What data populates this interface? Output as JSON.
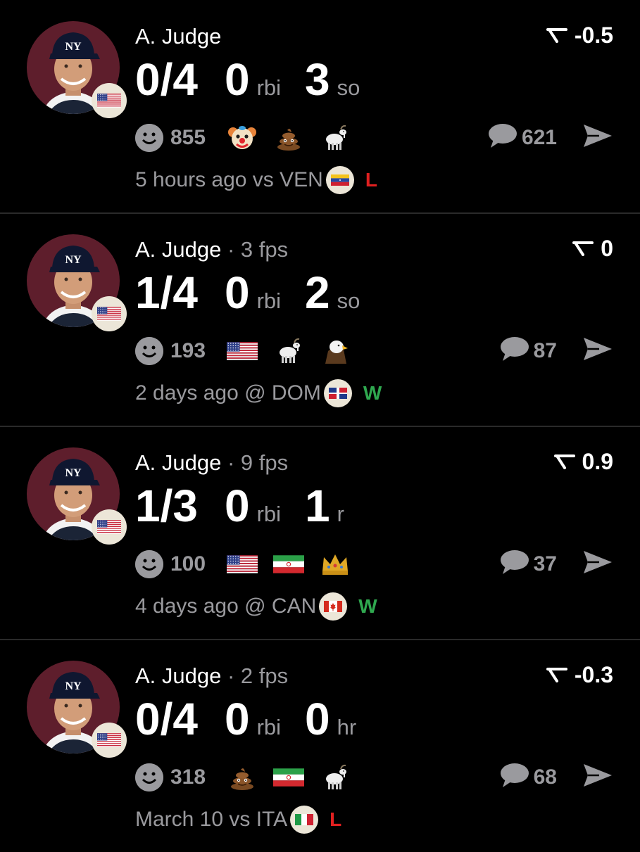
{
  "colors": {
    "loss": "#e02020",
    "win": "#2fa84f",
    "muted": "#9a9a9e",
    "avatar_bg": "#5e1e2c"
  },
  "games": [
    {
      "name": "A. Judge",
      "fps": "",
      "rating": "-0.5",
      "hits": "0/4",
      "rbi": "0",
      "rbi_unit": "rbi",
      "third_val": "3",
      "third_unit": "so",
      "reactions_count": "855",
      "reaction_icons": [
        "clown-emoji",
        "poop-emoji",
        "goat-emoji"
      ],
      "comments": "621",
      "time": "5 hours ago vs VEN",
      "opponent_flag": "venezuela-flag",
      "result": "L"
    },
    {
      "name": "A. Judge",
      "fps": " · 3 fps",
      "rating": "0",
      "hits": "1/4",
      "rbi": "0",
      "rbi_unit": "rbi",
      "third_val": "2",
      "third_unit": "so",
      "reactions_count": "193",
      "reaction_icons": [
        "usa-flag",
        "goat-emoji",
        "eagle-emoji"
      ],
      "comments": "87",
      "time": "2 days ago @ DOM",
      "opponent_flag": "dominican-flag",
      "result": "W"
    },
    {
      "name": "A. Judge",
      "fps": " · 9 fps",
      "rating": "0.9",
      "hits": "1/3",
      "rbi": "0",
      "rbi_unit": "rbi",
      "third_val": "1",
      "third_unit": "r",
      "reactions_count": "100",
      "reaction_icons": [
        "usa-flag",
        "iran-flag",
        "crown-emoji"
      ],
      "comments": "37",
      "time": "4 days ago @ CAN",
      "opponent_flag": "canada-flag",
      "result": "W"
    },
    {
      "name": "A. Judge",
      "fps": " · 2 fps",
      "rating": "-0.3",
      "hits": "0/4",
      "rbi": "0",
      "rbi_unit": "rbi",
      "third_val": "0",
      "third_unit": "hr",
      "reactions_count": "318",
      "reaction_icons": [
        "poop-emoji",
        "iran-flag",
        "goat-emoji"
      ],
      "comments": "68",
      "time": "March 10 vs ITA",
      "opponent_flag": "italy-flag",
      "result": "L"
    }
  ]
}
